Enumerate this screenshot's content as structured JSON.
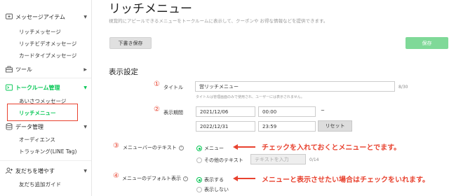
{
  "sidebar": {
    "message_items": {
      "label": "メッセージアイテム"
    },
    "rich_message": "リッチメッセージ",
    "rich_video_message": "リッチビデオメッセージ",
    "card_type_message": "カードタイプメッセージ",
    "tools": "ツール",
    "talk_room": "トークルーム管理",
    "greeting": "あいさつメッセージ",
    "rich_menu": "リッチメニュー",
    "data": "データ管理",
    "audience": "オーディエンス",
    "tracking": "トラッキング(LINE Tag)",
    "grow_friends": "友だちを増やす",
    "add_friend_guide": "友だち追加ガイド"
  },
  "page": {
    "title": "リッチメニュー",
    "description": "視覚的にアピールできるメニューをトークルームに表示して、クーポンや お得な情報などを提供できます。",
    "draft_button": "下書き保存",
    "save_button": "保存",
    "section_title": "表示設定"
  },
  "form": {
    "num1": "①",
    "title_label": "タイトル",
    "title_value": "営リッチメニュー",
    "title_count": "8/30",
    "title_hint": "タイトルは管理画面のみで使用され、ユーザーには表示されません。",
    "num2": "②",
    "period_label": "表示期間",
    "start_date": "2021/12/06",
    "start_time": "00:00",
    "tilde": "~",
    "end_date": "2022/12/31",
    "end_time": "23:59",
    "reset_button": "リセット",
    "num3": "③",
    "menubar_label": "メニューバーのテキスト",
    "opt_menu": "メニュー",
    "opt_other": "その他のテキスト",
    "other_placeholder": "テキストを入力",
    "other_count": "0/14",
    "num4": "④",
    "default_label": "メニューのデフォルト表示",
    "opt_show": "表示する",
    "opt_hide": "表示しない",
    "help_icon_text": "?"
  },
  "annotations": {
    "note1": "チェックを入れておくとメニューとでます。",
    "note2": "メニューと表示させたい場合はチェックをいれます。"
  },
  "colors": {
    "line_green": "#06c755",
    "annotation_red": "#e8422f",
    "save_disabled": "#7fd998"
  },
  "icons": {
    "message_items": "message-icon",
    "tools": "toolbox-icon",
    "talk_room": "chat-room-icon",
    "data": "database-icon",
    "grow_friends": "add-friend-icon"
  }
}
